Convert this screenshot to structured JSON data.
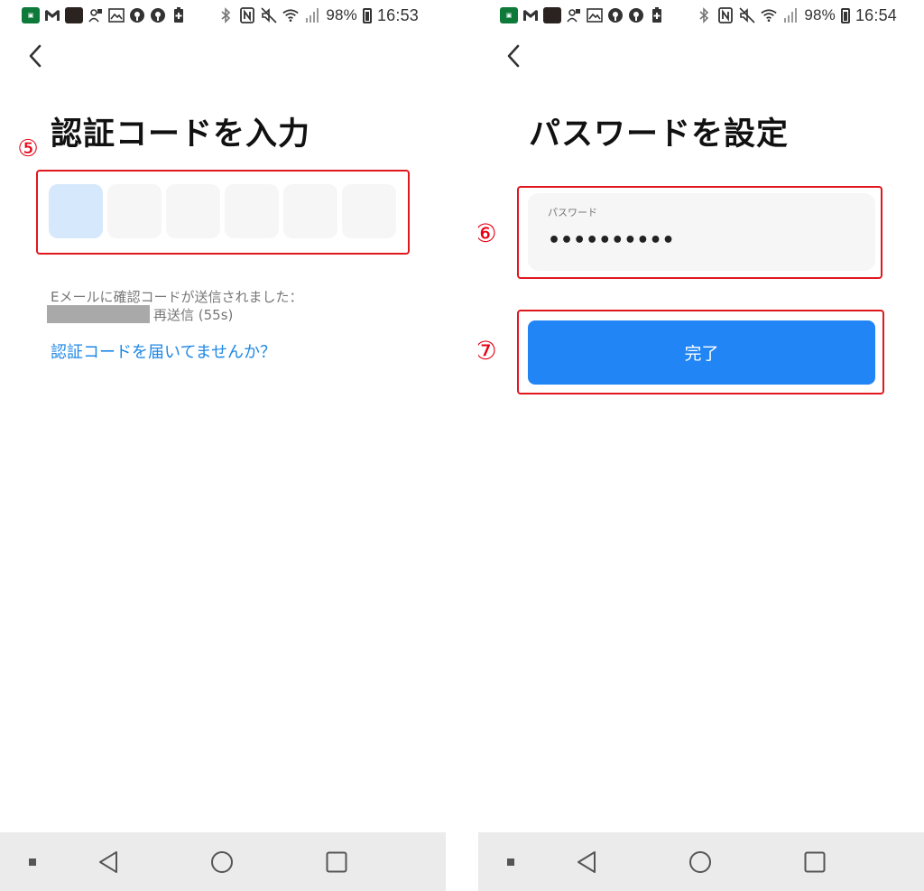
{
  "left_screen": {
    "status_bar": {
      "battery": "98%",
      "time": "16:53"
    },
    "title": "認証コードを入力",
    "callout": "⑤",
    "code_boxes": [
      "",
      "",
      "",
      "",
      "",
      ""
    ],
    "info": {
      "sent_message": "Eメールに確認コードが送信されました：",
      "resend": "再送信 (55s)"
    },
    "help_link": "認証コードを届いてませんか？"
  },
  "right_screen": {
    "status_bar": {
      "battery": "98%",
      "time": "16:54"
    },
    "title": "パスワードを設定",
    "callout_password": "⑥",
    "callout_button": "⑦",
    "password_field": {
      "label": "パスワード",
      "value": "••••••••••"
    },
    "done_button": "完了"
  },
  "icons": {
    "status_left": [
      "app-icon",
      "gmail-icon",
      "photo-app-icon",
      "person-lock-icon",
      "image-icon",
      "vpn-icon",
      "vpn-icon",
      "battery-saver-icon"
    ],
    "status_right": [
      "bluetooth-icon",
      "nfc-icon",
      "mute-icon",
      "wifi-icon",
      "signal-icon",
      "battery-icon"
    ],
    "nav": [
      "recent-dot-icon",
      "back-triangle-icon",
      "home-circle-icon",
      "overview-square-icon"
    ]
  },
  "colors": {
    "accent": "#2185f5",
    "link": "#1f88e5",
    "annotation": "#e60012",
    "active_box": "#d6e8fc",
    "field_bg": "#f6f6f6",
    "nav_bg": "#ebebeb"
  }
}
